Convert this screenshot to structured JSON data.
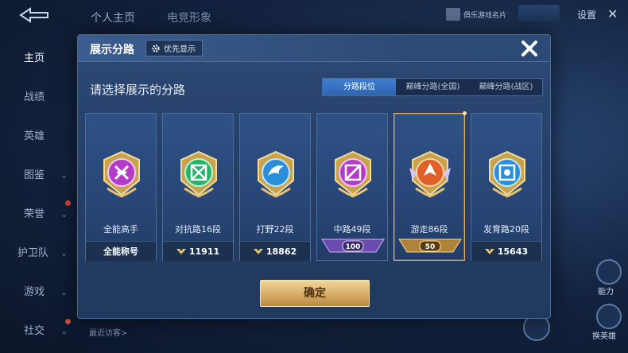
{
  "background": {
    "tabs": [
      "个人主页",
      "电竞形象"
    ],
    "card_button": "俱乐游戏名片",
    "settings": "设置",
    "sidebar": [
      {
        "label": "主页",
        "active": true
      },
      {
        "label": "战绩",
        "active": false
      },
      {
        "label": "英雄",
        "active": false
      },
      {
        "label": "图鉴",
        "active": false
      },
      {
        "label": "荣誉",
        "active": false
      },
      {
        "label": "护卫队",
        "active": false
      },
      {
        "label": "游戏",
        "active": false
      },
      {
        "label": "社交",
        "active": false
      }
    ],
    "recent_visitors": "最近访客>",
    "right_labels": [
      "能力",
      "换英雄"
    ]
  },
  "modal": {
    "title": "展示分路",
    "priority_button": "优先显示",
    "subtitle": "请选择展示的分路",
    "tabs": [
      {
        "label": "分路段位",
        "active": true
      },
      {
        "label": "巅峰分路(全国)",
        "active": false
      },
      {
        "label": "巅峰分路(战区)",
        "active": false
      }
    ],
    "cards": [
      {
        "label": "全能高手",
        "footer": "全能称号",
        "emblem": "purple-allround-emblem",
        "color": "#b23cc8"
      },
      {
        "label": "对抗路16段",
        "footer": "11911",
        "emblem": "green-clash-lane-emblem",
        "color": "#25b36a"
      },
      {
        "label": "打野22段",
        "footer": "18862",
        "emblem": "blue-jungle-emblem",
        "color": "#2a8fd8"
      },
      {
        "label": "中路49段",
        "footer": "100",
        "emblem": "purple-mid-lane-emblem",
        "color": "#b23cc8"
      },
      {
        "label": "游走86段",
        "footer": "50",
        "emblem": "orange-roam-emblem",
        "color": "#e0602a",
        "selected": true
      },
      {
        "label": "发育路20段",
        "footer": "15643",
        "emblem": "blue-farm-lane-emblem",
        "color": "#2a8fd8"
      }
    ],
    "confirm_button": "确定"
  }
}
